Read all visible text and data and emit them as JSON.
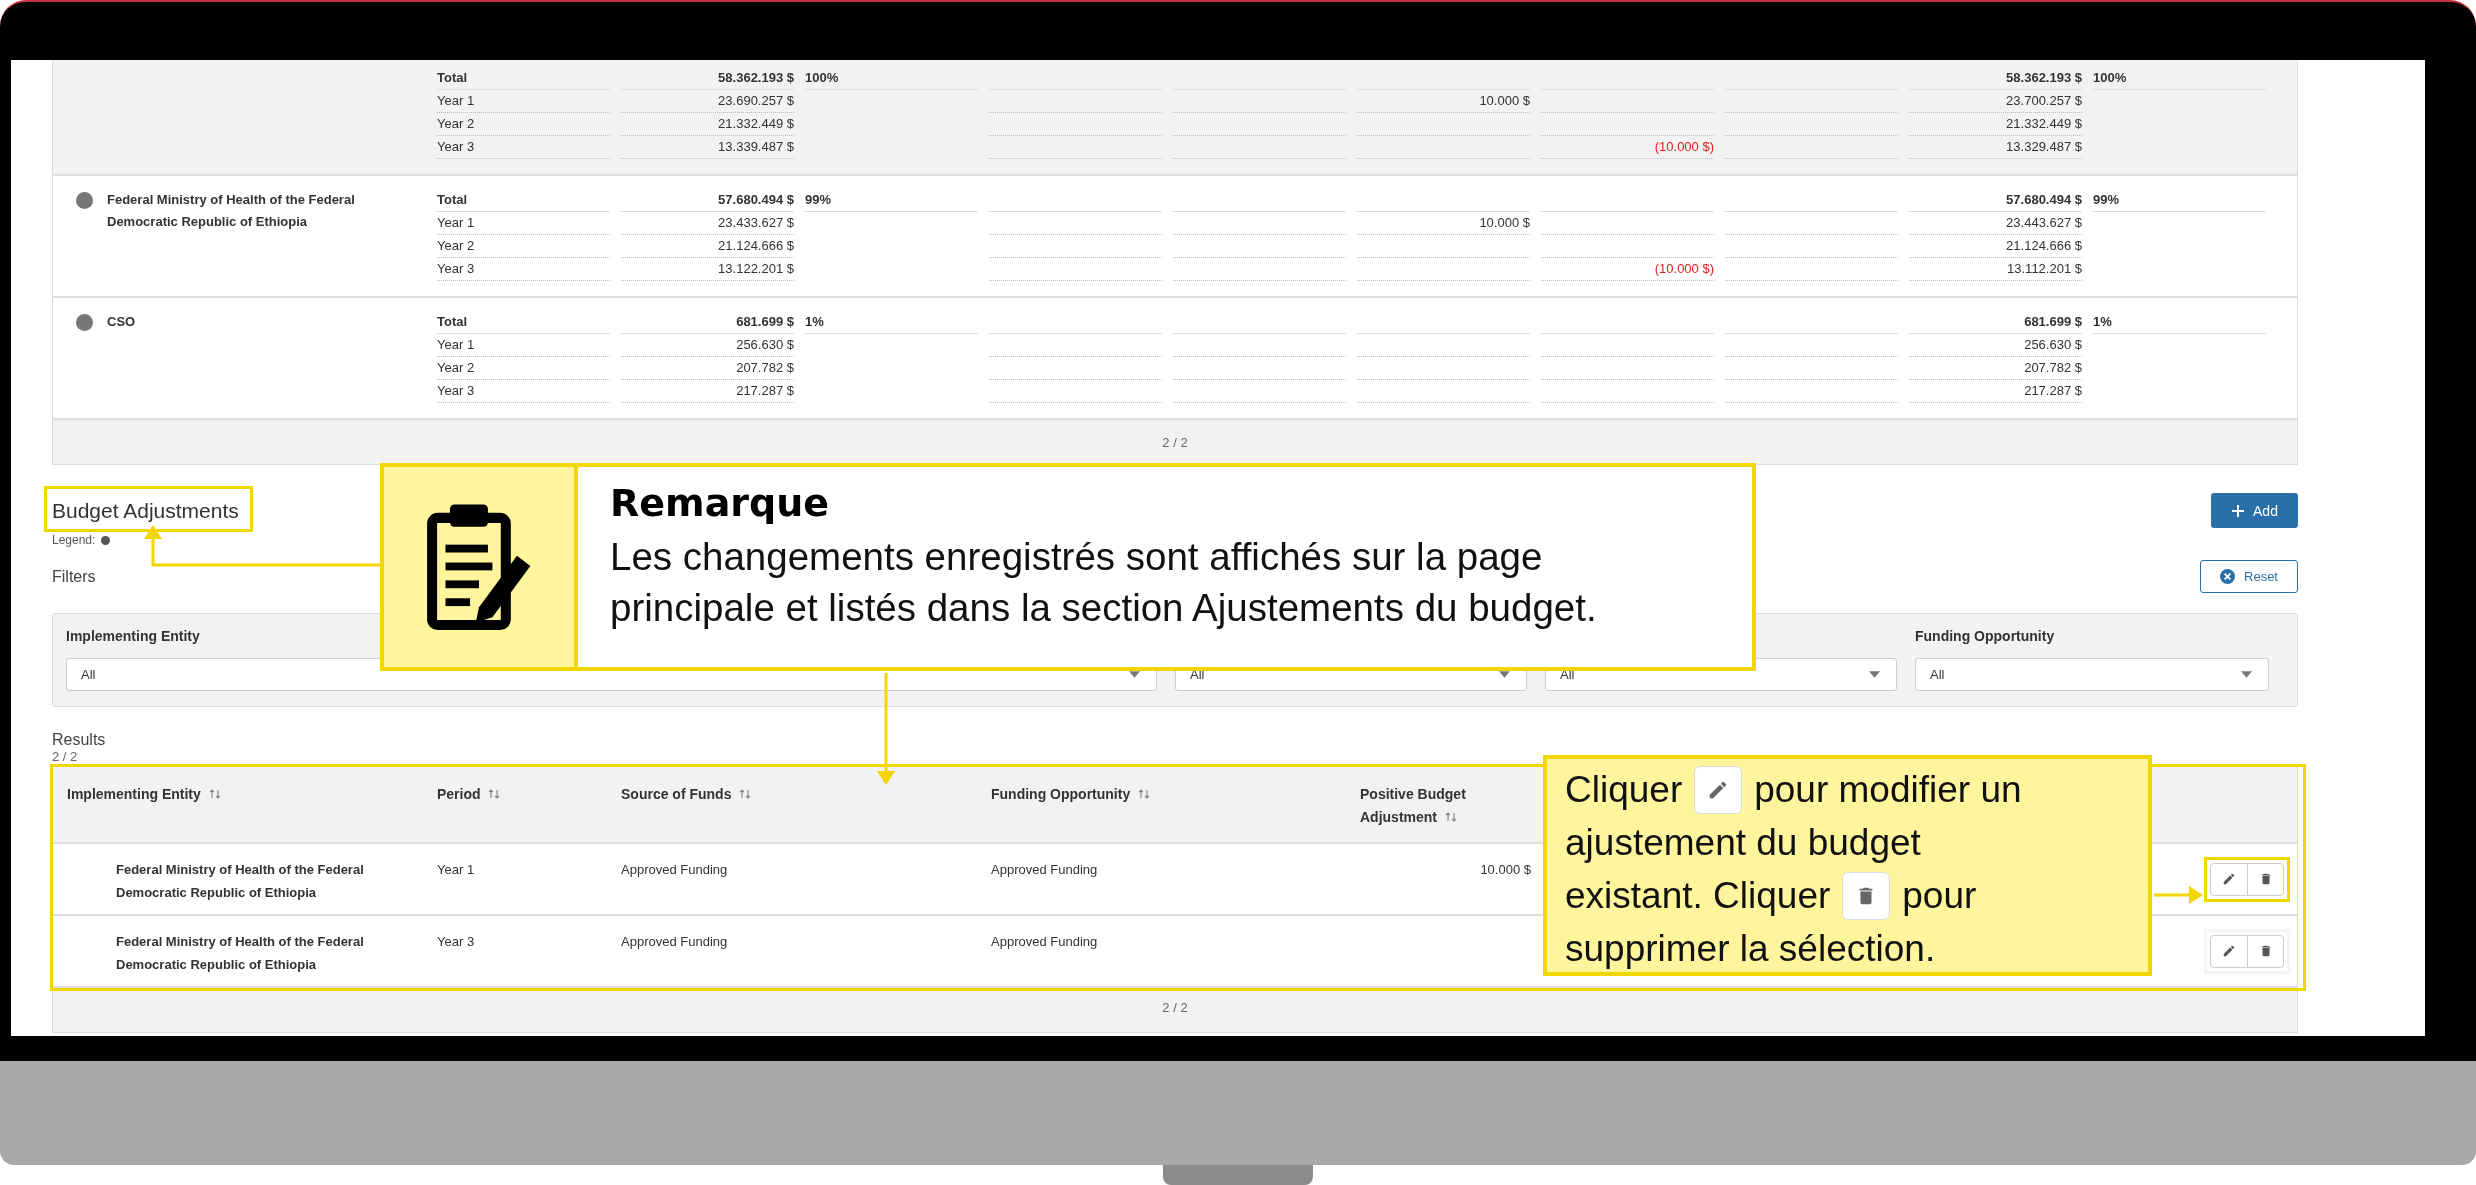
{
  "top_table": {
    "columns": [
      {
        "kind": "label"
      },
      {
        "kind": "amount"
      },
      {
        "kind": "share"
      },
      {
        "kind": "amount"
      },
      {
        "kind": "amount"
      },
      {
        "kind": "amount"
      },
      {
        "kind": "deduction"
      },
      {
        "kind": "amount"
      },
      {
        "kind": "amount"
      },
      {
        "kind": "share"
      }
    ],
    "groups": [
      {
        "highlighted": true,
        "rows": [
          {
            "kind": "total",
            "column_1": "Total",
            "column_2": "58.362.193 $",
            "column_3": "100%",
            "column_9": "58.362.193 $",
            "column_10": "100%"
          },
          {
            "kind": "year",
            "column_1": "Year 1",
            "column_2": "23.690.257 $",
            "column_6": "10.000 $",
            "column_9": "23.700.257 $"
          },
          {
            "kind": "year",
            "column_1": "Year 2",
            "column_2": "21.332.449 $",
            "column_9": "21.332.449 $"
          },
          {
            "kind": "year",
            "column_1": "Year 3",
            "column_2": "13.339.487 $",
            "column_7": "(10.000 $)",
            "column_9": "13.329.487 $"
          }
        ]
      },
      {
        "name": "Federal Ministry of Health of the Federal Democratic Republic of Ethiopia",
        "highlighted": false,
        "rows": [
          {
            "kind": "total",
            "column_1": "Total",
            "column_2": "57.680.494 $",
            "column_3": "99%",
            "column_9": "57.680.494 $",
            "column_10": "99%"
          },
          {
            "kind": "year",
            "column_1": "Year 1",
            "column_2": "23.433.627 $",
            "column_6": "10.000 $",
            "column_9": "23.443.627 $"
          },
          {
            "kind": "year",
            "column_1": "Year 2",
            "column_2": "21.124.666 $",
            "column_9": "21.124.666 $"
          },
          {
            "kind": "year",
            "column_1": "Year 3",
            "column_2": "13.122.201 $",
            "column_7": "(10.000 $)",
            "column_9": "13.112.201 $"
          }
        ]
      },
      {
        "name": "CSO",
        "highlighted": false,
        "rows": [
          {
            "kind": "total",
            "column_1": "Total",
            "column_2": "681.699 $",
            "column_3": "1%",
            "column_9": "681.699 $",
            "column_10": "1%"
          },
          {
            "kind": "year",
            "column_1": "Year 1",
            "column_2": "256.630 $",
            "column_9": "256.630 $"
          },
          {
            "kind": "year",
            "column_1": "Year 2",
            "column_2": "207.782 $",
            "column_9": "207.782 $"
          },
          {
            "kind": "year",
            "column_1": "Year 3",
            "column_2": "217.287 $",
            "column_9": "217.287 $"
          }
        ]
      }
    ],
    "pagination": "2 / 2"
  },
  "budget_adjustments": {
    "title": "Budget Adjustments",
    "legend_label": "Legend:",
    "add_button": "Add",
    "filters_label": "Filters",
    "reset_button": "Reset",
    "filters": [
      {
        "label": "Implementing Entity",
        "value": "All"
      },
      {
        "value": "All"
      },
      {
        "value": "All"
      },
      {
        "label": "Funding Opportunity",
        "value": "All"
      }
    ],
    "results_label": "Results",
    "results_count": "2 / 2",
    "results_table": {
      "columns": [
        "Implementing Entity",
        "Period",
        "Source of Funds",
        "Funding Opportunity",
        "Positive Budget Adjustment"
      ],
      "rows": [
        {
          "highlighted": true,
          "cells": [
            "Federal Ministry of Health of the Federal Democratic Republic of Ethiopia",
            "Year 1",
            "Approved Funding",
            "Approved Funding",
            "10.000 $"
          ]
        },
        {
          "highlighted": false,
          "cells": [
            "Federal Ministry of Health of the Federal Democratic Republic of Ethiopia",
            "Year 3",
            "Approved Funding",
            "Approved Funding"
          ]
        }
      ],
      "pagination": "2 / 2"
    }
  },
  "note_callout": {
    "title": "Remarque",
    "text": "Les changements enregistrés sont affichés sur la page principale et listés dans la section Ajustements du budget."
  },
  "action_callout": {
    "lines": [
      [
        {
          "kind": "text",
          "text": "Cliquer"
        },
        {
          "kind": "edit_icon"
        },
        {
          "kind": "text",
          "text": "pour modifier un"
        }
      ],
      [
        {
          "kind": "text",
          "text": "ajustement du budget"
        }
      ],
      [
        {
          "kind": "text",
          "text": "existant. Cliquer"
        },
        {
          "kind": "delete_icon"
        },
        {
          "kind": "text",
          "text": "pour"
        }
      ],
      [
        {
          "kind": "text",
          "text": "supprimer la sélection."
        }
      ]
    ]
  }
}
